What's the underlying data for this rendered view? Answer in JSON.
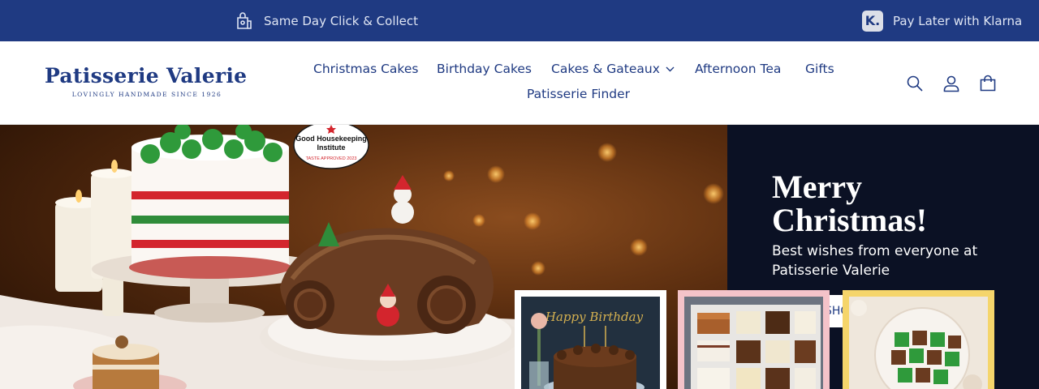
{
  "announcement": {
    "left_text": "Same Day Click & Collect",
    "left_icon": "shopping-bag-icon",
    "right_text": "Pay Later with Klarna",
    "right_icon": "klarna-icon",
    "klarna_letter": "K.",
    "background": "#1f3a82"
  },
  "logo": {
    "name": "Patisserie Valerie",
    "tagline": "LOVINGLY HANDMADE SINCE 1926"
  },
  "nav": {
    "items": [
      {
        "label": "Christmas Cakes"
      },
      {
        "label": "Birthday Cakes"
      },
      {
        "label": "Cakes & Gateaux",
        "has_dropdown": true
      },
      {
        "label": "Afternoon Tea"
      },
      {
        "label": "Gifts"
      },
      {
        "label": "Patisserie Finder"
      }
    ]
  },
  "header_icons": [
    "search-icon",
    "account-icon",
    "cart-icon"
  ],
  "hero": {
    "title": "Merry Christmas!",
    "subtitle": "Best wishes from everyone at Patisserie Valerie",
    "button_label": "SHOW",
    "badge_line1": "Good Housekeeping",
    "badge_line2": "Institute",
    "badge_line3": "TASTE APPROVED 2023",
    "panel_color": "#0b1124"
  },
  "thumbnails": [
    {
      "name": "birthday-cake-thumbnail",
      "border_color": "#ffffff",
      "topper_text": "Happy Birthday"
    },
    {
      "name": "patisserie-slices-thumbnail",
      "border_color": "#f4c3c9"
    },
    {
      "name": "christmas-fancies-thumbnail",
      "border_color": "#f5d56b"
    }
  ],
  "colors": {
    "brand_blue": "#1f3a82",
    "white": "#ffffff"
  }
}
